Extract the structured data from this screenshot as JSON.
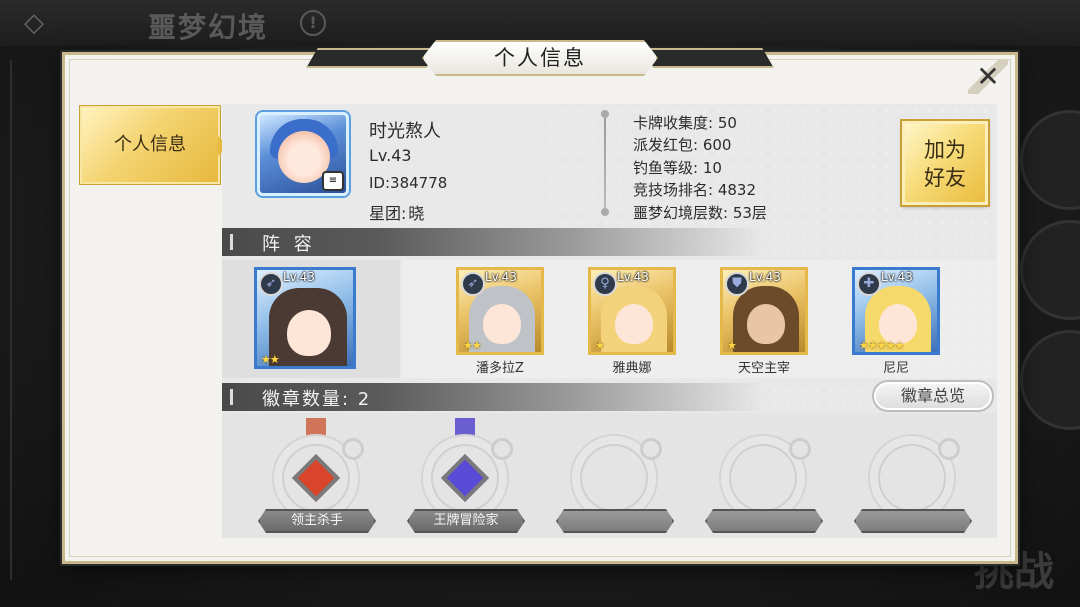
{
  "background": {
    "title": "噩梦幻境",
    "info_icon": "!",
    "challenge_label": "挑战"
  },
  "dialog": {
    "title": "个人信息",
    "close_icon": "✕",
    "side_tab_label": "个人信息"
  },
  "player": {
    "name": "时光熬人",
    "level": "Lv.43",
    "id": "ID:384778",
    "star_group_label": "星团:",
    "star_group": "晓"
  },
  "stats": [
    "卡牌收集度: 50",
    "派发红包: 600",
    "钓鱼等级: 10",
    "竞技场排名: 4832",
    "噩梦幻境层数: 53层"
  ],
  "add_friend": {
    "line1": "加为",
    "line2": "好友"
  },
  "lineup": {
    "header": "阵 容",
    "heroes": [
      {
        "name": "",
        "level": "Lv.43",
        "stars": "★★",
        "rarity": "blue",
        "class_icon": "bow-icon",
        "hair": "#4a3a33"
      },
      {
        "name": "潘多拉Z",
        "level": "Lv.43",
        "stars": "★★",
        "rarity": "gold",
        "class_icon": "bow-icon",
        "hair": "#bfc3c8"
      },
      {
        "name": "雅典娜",
        "level": "Lv.43",
        "stars": "★",
        "rarity": "gold",
        "class_icon": "staff-icon",
        "hair": "#f2d27a"
      },
      {
        "name": "天空主宰",
        "level": "Lv.43",
        "stars": "★",
        "rarity": "gold",
        "class_icon": "shield-icon",
        "hair": "#6b4b2a"
      },
      {
        "name": "尼尼",
        "level": "Lv.43",
        "stars": "★★★★★",
        "rarity": "blue",
        "class_icon": "heal-icon",
        "hair": "#f5d96b"
      }
    ]
  },
  "badges": {
    "header": "徽章数量: 2",
    "overview_button": "徽章总览",
    "items": [
      {
        "name": "领主杀手",
        "gem_color": "#d8452a",
        "ribbon_color": "#d0745a",
        "earned": true
      },
      {
        "name": "王牌冒险家",
        "gem_color": "#5a4bd6",
        "ribbon_color": "#6b5ed0",
        "earned": true
      },
      {
        "name": "",
        "earned": false
      },
      {
        "name": "",
        "earned": false
      },
      {
        "name": "",
        "earned": false
      }
    ]
  }
}
